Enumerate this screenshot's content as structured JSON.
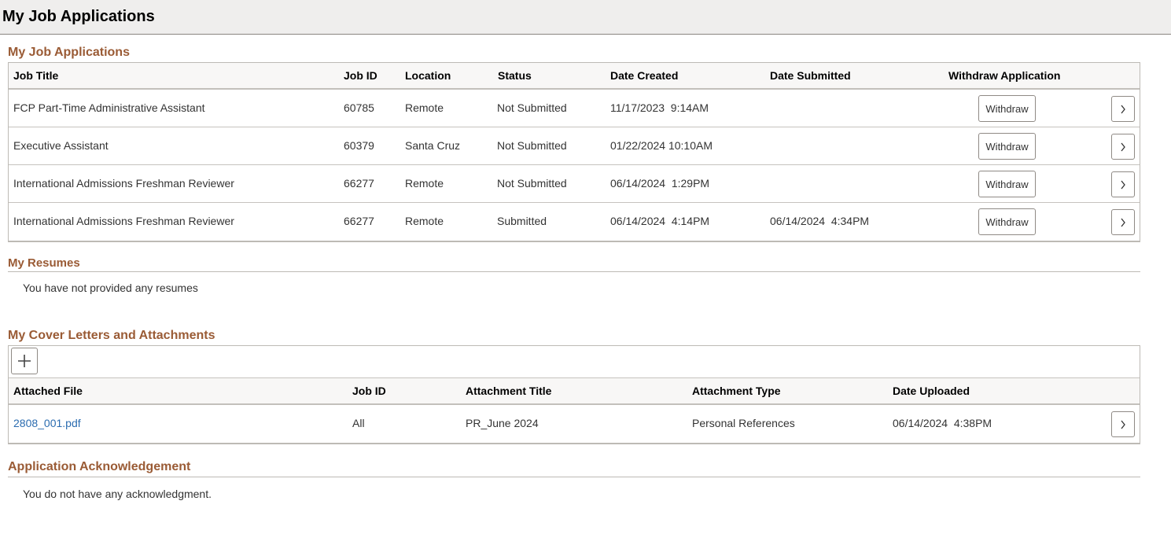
{
  "page": {
    "title": "My Job Applications"
  },
  "applications": {
    "title": "My Job Applications",
    "columns": [
      "Job Title",
      "Job ID",
      "Location",
      "Status",
      "Date Created",
      "Date Submitted",
      "Withdraw Application"
    ],
    "rows": [
      {
        "job_title": "FCP Part-Time Administrative Assistant",
        "job_id": "60785",
        "location": "Remote",
        "status": "Not Submitted",
        "date_created": "11/17/2023  9:14AM",
        "date_submitted": "",
        "withdraw_label": "Withdraw"
      },
      {
        "job_title": "Executive Assistant",
        "job_id": "60379",
        "location": "Santa Cruz",
        "status": "Not Submitted",
        "date_created": "01/22/2024 10:10AM",
        "date_submitted": "",
        "withdraw_label": "Withdraw"
      },
      {
        "job_title": "International Admissions Freshman Reviewer",
        "job_id": "66277",
        "location": "Remote",
        "status": "Not Submitted",
        "date_created": "06/14/2024  1:29PM",
        "date_submitted": "",
        "withdraw_label": "Withdraw"
      },
      {
        "job_title": "International Admissions Freshman Reviewer",
        "job_id": "66277",
        "location": "Remote",
        "status": "Submitted",
        "date_created": "06/14/2024  4:14PM",
        "date_submitted": "06/14/2024  4:34PM",
        "withdraw_label": "Withdraw"
      }
    ]
  },
  "resumes": {
    "title": "My Resumes",
    "message": "You have not provided any resumes"
  },
  "attachments": {
    "title": "My Cover Letters and Attachments",
    "add_icon": "plus-icon",
    "columns": [
      "Attached File",
      "Job ID",
      "Attachment Title",
      "Attachment Type",
      "Date Uploaded"
    ],
    "rows": [
      {
        "file": "2808_001.pdf",
        "job_id": "All",
        "title": "PR_June 2024",
        "type": "Personal References",
        "date_uploaded": "06/14/2024  4:38PM"
      }
    ]
  },
  "acknowledgement": {
    "title": "Application Acknowledgement",
    "message": "You do not have any acknowledgment."
  },
  "icons": {
    "row_action": "chevron-right-icon"
  },
  "colors": {
    "section_title": "#9a5b35",
    "link": "#2b6cb0"
  }
}
